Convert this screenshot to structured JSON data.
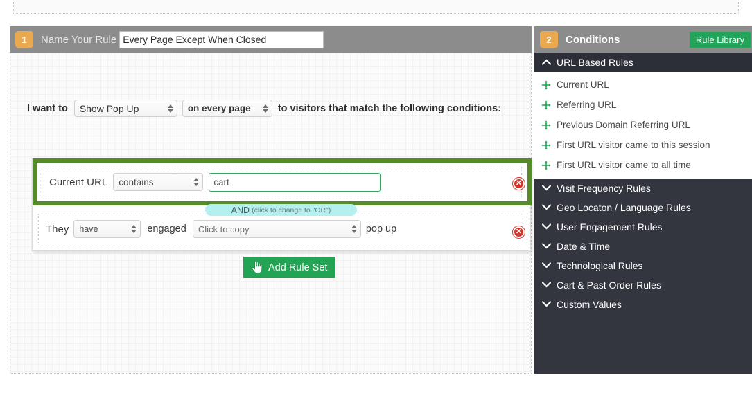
{
  "left_panel": {
    "step_number": "1",
    "name_label": "Name Your Rule",
    "rule_name_value": "Every Page Except When Closed",
    "rule_name_placeholder": "Name Your Rule",
    "want_prefix": "I want to",
    "action_select": "Show Pop Up",
    "scope_select": "on every page",
    "want_suffix": "to visitors that match the following conditions:",
    "rule_rows": [
      {
        "label": "Current URL",
        "operator": "contains",
        "value": "cart",
        "value_placeholder": "",
        "delete_icon": "delete-circle-icon"
      }
    ],
    "and_pill": {
      "word": "AND",
      "hint": "(click to change to \"OR\")"
    },
    "engagement_row": {
      "prefix": "They",
      "have_select": "have",
      "middle": "engaged",
      "popup_select": "Click to copy",
      "suffix": "pop up",
      "delete_icon": "delete-circle-icon"
    },
    "add_rule_set": {
      "label": "Add Rule Set",
      "icon": "pointing-hand-icon"
    }
  },
  "right_panel": {
    "step_number": "2",
    "title": "Conditions",
    "rule_library_label": "Rule Library",
    "groups": [
      {
        "label": "URL Based Rules",
        "caret": "chevron-up-icon",
        "expanded": true,
        "items": [
          {
            "label": "Current URL",
            "icon": "move-arrows-icon"
          },
          {
            "label": "Referring URL",
            "icon": "move-arrows-icon"
          },
          {
            "label": "Previous Domain Referring URL",
            "icon": "move-arrows-icon"
          },
          {
            "label": "First URL visitor came to this session",
            "icon": "move-arrows-icon"
          },
          {
            "label": "First URL visitor came to all time",
            "icon": "move-arrows-icon"
          }
        ]
      },
      {
        "label": "Visit Frequency Rules",
        "caret": "chevron-down-icon",
        "expanded": false,
        "items": []
      },
      {
        "label": "Geo Locaton / Language Rules",
        "caret": "chevron-down-icon",
        "expanded": false,
        "items": []
      },
      {
        "label": "User Engagement Rules",
        "caret": "chevron-down-icon",
        "expanded": false,
        "items": []
      },
      {
        "label": "Date & Time",
        "caret": "chevron-down-icon",
        "expanded": false,
        "items": []
      },
      {
        "label": "Technological Rules",
        "caret": "chevron-down-icon",
        "expanded": false,
        "items": []
      },
      {
        "label": "Cart & Past Order Rules",
        "caret": "chevron-down-icon",
        "expanded": false,
        "items": []
      },
      {
        "label": "Custom Values",
        "caret": "chevron-down-icon",
        "expanded": false,
        "items": []
      }
    ]
  },
  "colors": {
    "header_gray": "#8c8c8c",
    "badge_orange": "#eaa94f",
    "accent_green": "#22a45a",
    "highlight_green": "#548c27",
    "panel_dark": "#33353f",
    "delete_red": "#d8332a",
    "and_pill_cyan": "#b4f0ef"
  }
}
